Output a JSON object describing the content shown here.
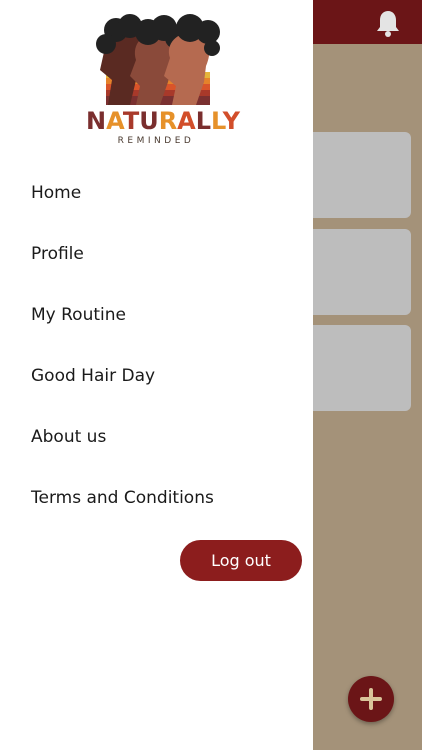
{
  "logo": {
    "title_letters": [
      "N",
      "A",
      "T",
      "U",
      "R",
      "A",
      "L",
      "L",
      "Y"
    ],
    "title_colors": [
      "#7a2e2e",
      "#e6912a",
      "#a8392a",
      "#7a2e2e",
      "#e6912a",
      "#d24e2a",
      "#7a2e2e",
      "#e6912a",
      "#d24e2a"
    ],
    "subtitle": "REMINDED"
  },
  "menu": {
    "items": [
      {
        "label": "Home"
      },
      {
        "label": "Profile"
      },
      {
        "label": "My Routine"
      },
      {
        "label": "Good Hair Day"
      },
      {
        "label": "About us"
      },
      {
        "label": "Terms and Conditions"
      }
    ]
  },
  "logout": {
    "label": "Log out"
  },
  "app": {
    "bell_icon": "bell-icon",
    "fab_icon": "plus-icon"
  },
  "colors": {
    "primary": "#6b1517",
    "button": "#8c1d1d",
    "background": "#a49279",
    "card": "#bdbdbd",
    "fab_plus": "#d9c49a"
  }
}
